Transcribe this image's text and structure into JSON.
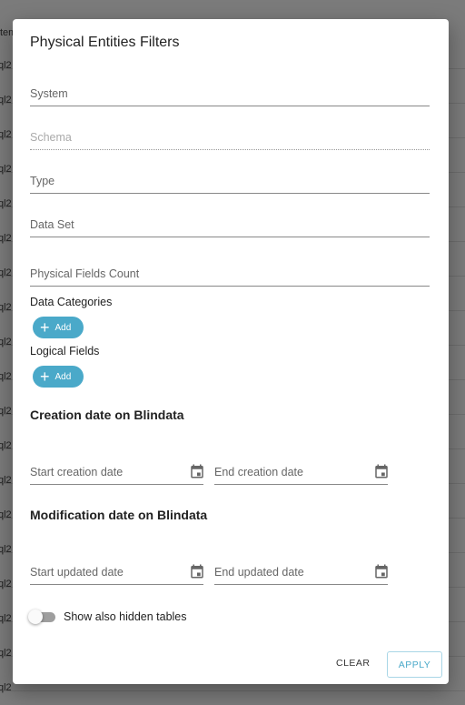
{
  "background": {
    "header_fragment": "tem",
    "row_fragments": [
      "ql2",
      "ql2",
      "ql2",
      "ql2",
      "ql2",
      "ql2",
      "ql2",
      "ql2",
      "ql2",
      "ql2",
      "ql2",
      "ql2",
      "ql2",
      "ql2",
      "ql2",
      "ql2",
      "ql2",
      "ql2",
      "ql2"
    ]
  },
  "dialog": {
    "title": "Physical Entities Filters",
    "fields": {
      "system": "System",
      "schema": "Schema",
      "type": "Type",
      "data_set": "Data Set",
      "physical_fields_count": "Physical Fields Count"
    },
    "data_categories": {
      "label": "Data Categories",
      "add": "Add"
    },
    "logical_fields": {
      "label": "Logical Fields",
      "add": "Add"
    },
    "creation": {
      "title": "Creation date on Blindata",
      "start": "Start creation date",
      "end": "End creation date"
    },
    "modification": {
      "title": "Modification date on Blindata",
      "start": "Start updated date",
      "end": "End updated date"
    },
    "toggle": {
      "label": "Show also hidden tables",
      "checked": false
    },
    "actions": {
      "clear": "CLEAR",
      "apply": "APPLY"
    },
    "colors": {
      "accent": "#4aa9c9"
    }
  }
}
